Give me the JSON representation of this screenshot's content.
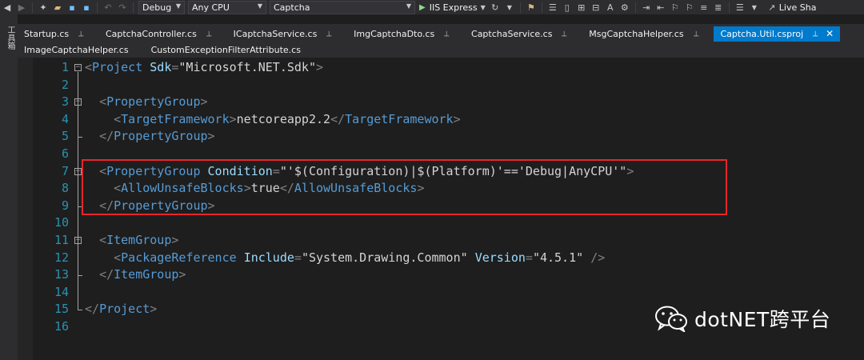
{
  "toolbar": {
    "config_combo": "Debug",
    "platform_combo": "Any CPU",
    "project_combo": "Captcha",
    "run_label": "IIS Express",
    "live_share_label": "Live Sha",
    "icons": [
      "back-icon",
      "forward-icon",
      "new-project-icon",
      "open-icon",
      "save-icon",
      "save-all-icon",
      "undo-icon",
      "redo-icon",
      "refresh-icon",
      "deploy-icon",
      "toggle-icon",
      "format-icon",
      "settings-icon",
      "indent-icon",
      "outdent-icon",
      "bookmark-icon",
      "comment-icon",
      "live-share-icon"
    ]
  },
  "side_strip": {
    "label": "工具箱"
  },
  "tabs": {
    "row1": [
      {
        "label": "Startup.cs",
        "active": false
      },
      {
        "label": "CaptchaController.cs",
        "active": false
      },
      {
        "label": "ICaptchaService.cs",
        "active": false
      },
      {
        "label": "ImgCaptchaDto.cs",
        "active": false
      },
      {
        "label": "CaptchaService.cs",
        "active": false
      },
      {
        "label": "MsgCaptchaHelper.cs",
        "active": false
      },
      {
        "label": "Captcha.Util.csproj",
        "active": true
      }
    ],
    "row2": [
      {
        "label": "ImageCaptchaHelper.cs"
      },
      {
        "label": "CustomExceptionFilterAttribute.cs"
      }
    ]
  },
  "editor": {
    "lines": [
      {
        "n": "1",
        "fold": "⊟",
        "parts": [
          [
            "p",
            "<"
          ],
          [
            "t",
            "Project"
          ],
          [
            "v",
            " "
          ],
          [
            "a",
            "Sdk"
          ],
          [
            "p",
            "="
          ],
          [
            "v",
            "\"Microsoft.NET.Sdk\""
          ],
          [
            "p",
            ">"
          ]
        ]
      },
      {
        "n": "2",
        "fold": "",
        "parts": []
      },
      {
        "n": "3",
        "fold": "⊟",
        "parts": [
          [
            "v",
            "  "
          ],
          [
            "p",
            "<"
          ],
          [
            "t",
            "PropertyGroup"
          ],
          [
            "p",
            ">"
          ]
        ]
      },
      {
        "n": "4",
        "fold": "",
        "parts": [
          [
            "v",
            "    "
          ],
          [
            "p",
            "<"
          ],
          [
            "t",
            "TargetFramework"
          ],
          [
            "p",
            ">"
          ],
          [
            "v",
            "netcoreapp2.2"
          ],
          [
            "p",
            "</"
          ],
          [
            "t",
            "TargetFramework"
          ],
          [
            "p",
            ">"
          ]
        ]
      },
      {
        "n": "5",
        "fold": "",
        "parts": [
          [
            "v",
            "  "
          ],
          [
            "p",
            "</"
          ],
          [
            "t",
            "PropertyGroup"
          ],
          [
            "p",
            ">"
          ]
        ]
      },
      {
        "n": "6",
        "fold": "",
        "parts": []
      },
      {
        "n": "7",
        "fold": "⊟",
        "parts": [
          [
            "v",
            "  "
          ],
          [
            "p",
            "<"
          ],
          [
            "t",
            "PropertyGroup"
          ],
          [
            "v",
            " "
          ],
          [
            "a",
            "Condition"
          ],
          [
            "p",
            "="
          ],
          [
            "v",
            "\"'$(Configuration)|$(Platform)'=='Debug|AnyCPU'\""
          ],
          [
            "p",
            ">"
          ]
        ]
      },
      {
        "n": "8",
        "fold": "",
        "parts": [
          [
            "v",
            "    "
          ],
          [
            "p",
            "<"
          ],
          [
            "t",
            "AllowUnsafeBlocks"
          ],
          [
            "p",
            ">"
          ],
          [
            "v",
            "true"
          ],
          [
            "p",
            "</"
          ],
          [
            "t",
            "AllowUnsafeBlocks"
          ],
          [
            "p",
            ">"
          ]
        ]
      },
      {
        "n": "9",
        "fold": "",
        "parts": [
          [
            "v",
            "  "
          ],
          [
            "p",
            "</"
          ],
          [
            "t",
            "PropertyGroup"
          ],
          [
            "p",
            ">"
          ]
        ]
      },
      {
        "n": "10",
        "fold": "",
        "parts": []
      },
      {
        "n": "11",
        "fold": "⊟",
        "parts": [
          [
            "v",
            "  "
          ],
          [
            "p",
            "<"
          ],
          [
            "t",
            "ItemGroup"
          ],
          [
            "p",
            ">"
          ]
        ]
      },
      {
        "n": "12",
        "fold": "",
        "parts": [
          [
            "v",
            "    "
          ],
          [
            "p",
            "<"
          ],
          [
            "t",
            "PackageReference"
          ],
          [
            "v",
            " "
          ],
          [
            "a",
            "Include"
          ],
          [
            "p",
            "="
          ],
          [
            "v",
            "\"System.Drawing.Common\""
          ],
          [
            "v",
            " "
          ],
          [
            "a",
            "Version"
          ],
          [
            "p",
            "="
          ],
          [
            "v",
            "\"4.5.1\""
          ],
          [
            "v",
            " "
          ],
          [
            "p",
            "/>"
          ]
        ]
      },
      {
        "n": "13",
        "fold": "",
        "parts": [
          [
            "v",
            "  "
          ],
          [
            "p",
            "</"
          ],
          [
            "t",
            "ItemGroup"
          ],
          [
            "p",
            ">"
          ]
        ]
      },
      {
        "n": "14",
        "fold": "",
        "parts": []
      },
      {
        "n": "15",
        "fold": "",
        "parts": [
          [
            "p",
            "</"
          ],
          [
            "t",
            "Project"
          ],
          [
            "p",
            ">"
          ]
        ]
      },
      {
        "n": "16",
        "fold": "",
        "parts": []
      }
    ]
  },
  "watermark": {
    "text": "dotNET跨平台"
  },
  "colors": {
    "accent": "#007acc",
    "highlight_border": "#e8252c",
    "background": "#1e1e1e"
  }
}
